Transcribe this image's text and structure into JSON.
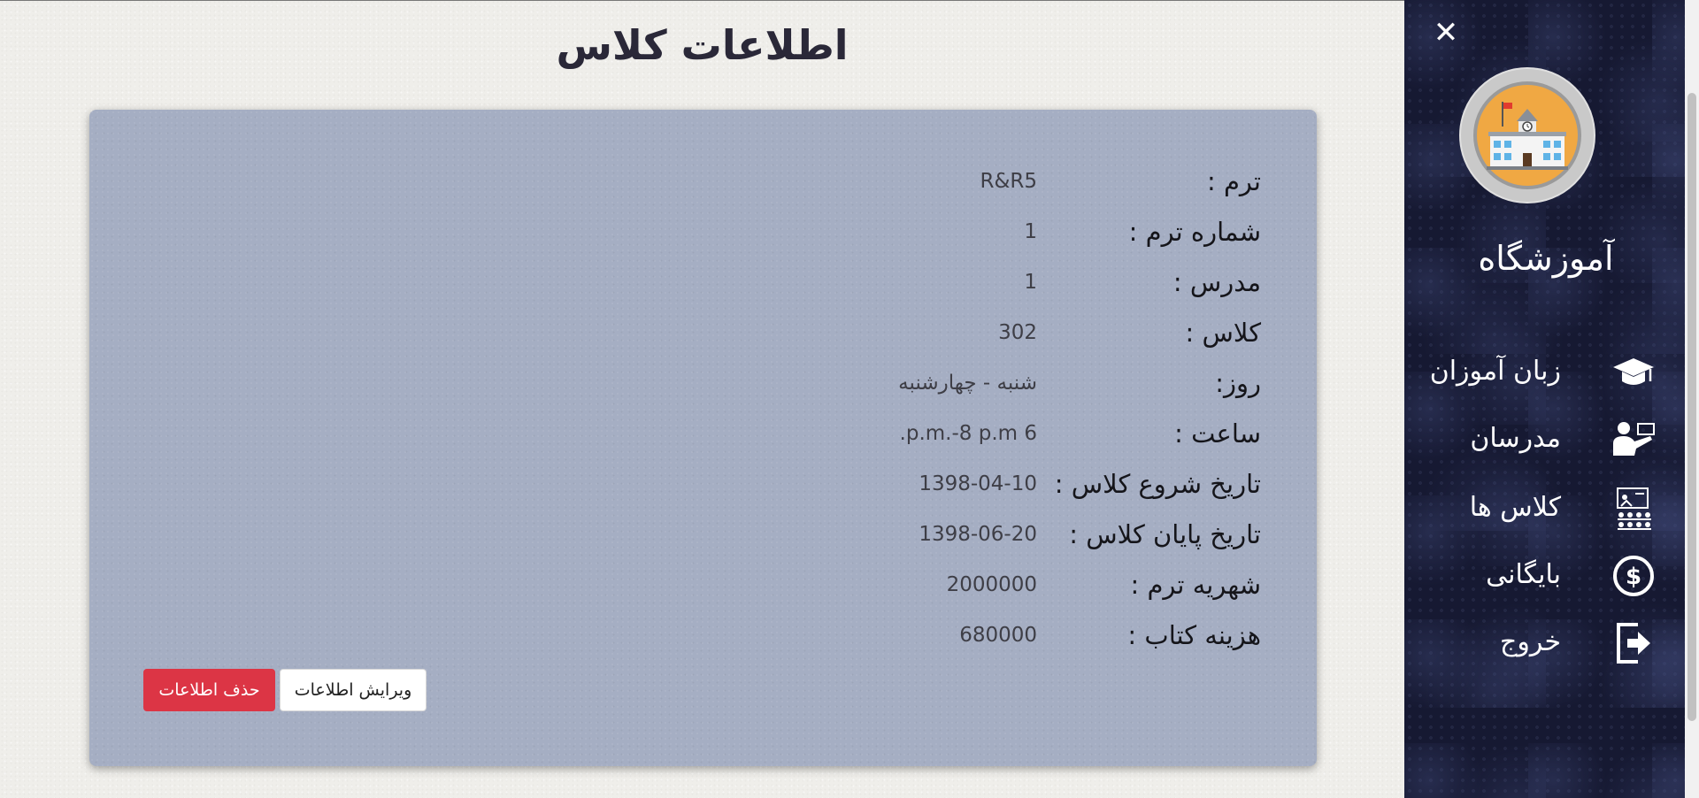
{
  "page": {
    "title": "اطلاعات کلاس"
  },
  "details": [
    {
      "label": "ترم :",
      "value": "R&R5"
    },
    {
      "label": "شماره ترم :",
      "value": "1"
    },
    {
      "label": "مدرس :",
      "value": "1"
    },
    {
      "label": "کلاس :",
      "value": "302"
    },
    {
      "label": "روز:",
      "value": "شنبه - چهارشنبه"
    },
    {
      "label": "ساعت :",
      "value": "6 p.m.-8 p.m."
    },
    {
      "label": "تاریخ شروع کلاس :",
      "value": "1398-04-10"
    },
    {
      "label": "تاریخ پایان کلاس :",
      "value": "1398-06-20"
    },
    {
      "label": "شهریه ترم :",
      "value": "2000000"
    },
    {
      "label": "هزینه کتاب :",
      "value": "680000"
    }
  ],
  "actions": {
    "edit_label": "ویرایش اطلاعات",
    "delete_label": "حذف اطلاعات"
  },
  "sidebar": {
    "close_symbol": "✕",
    "brand": "آموزشگاه",
    "items": [
      {
        "label": "زبان آموزان",
        "icon": "graduation-cap-icon"
      },
      {
        "label": "مدرسان",
        "icon": "teacher-icon"
      },
      {
        "label": "کلاس ها",
        "icon": "classroom-icon"
      },
      {
        "label": "بایگانی",
        "icon": "dollar-icon"
      },
      {
        "label": "خروج",
        "icon": "logout-icon"
      }
    ]
  },
  "colors": {
    "card": "#a5aec3",
    "delete": "#dc3545",
    "sidebar": "#161932"
  }
}
